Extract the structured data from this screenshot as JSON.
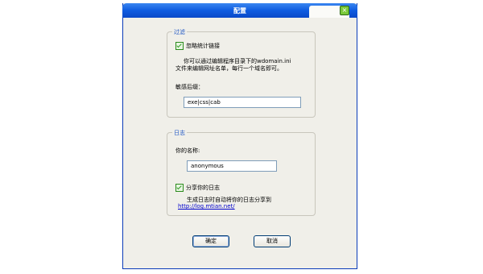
{
  "window": {
    "title": "配置",
    "close_glyph": "×"
  },
  "filter": {
    "legend": "过滤",
    "ignore_stats_label": "忽略统计链接",
    "description_line1": "你可以通过编辑程序目录下的wdomain.ini",
    "description_line2": "文件来编辑网址名单，每行一个域名即可。",
    "sensitive_suffix_label": "敏感后缀：",
    "sensitive_suffix_value": "exe|css|cab"
  },
  "log": {
    "legend": "日志",
    "name_label": "你的名称:",
    "name_value": "anonymous",
    "share_label": "分享你的日志",
    "share_description": "生成日志时自动将你的日志分享到",
    "share_link": "http://log.mtian.net/"
  },
  "buttons": {
    "ok_label": "确定",
    "cancel_label": "取消"
  }
}
